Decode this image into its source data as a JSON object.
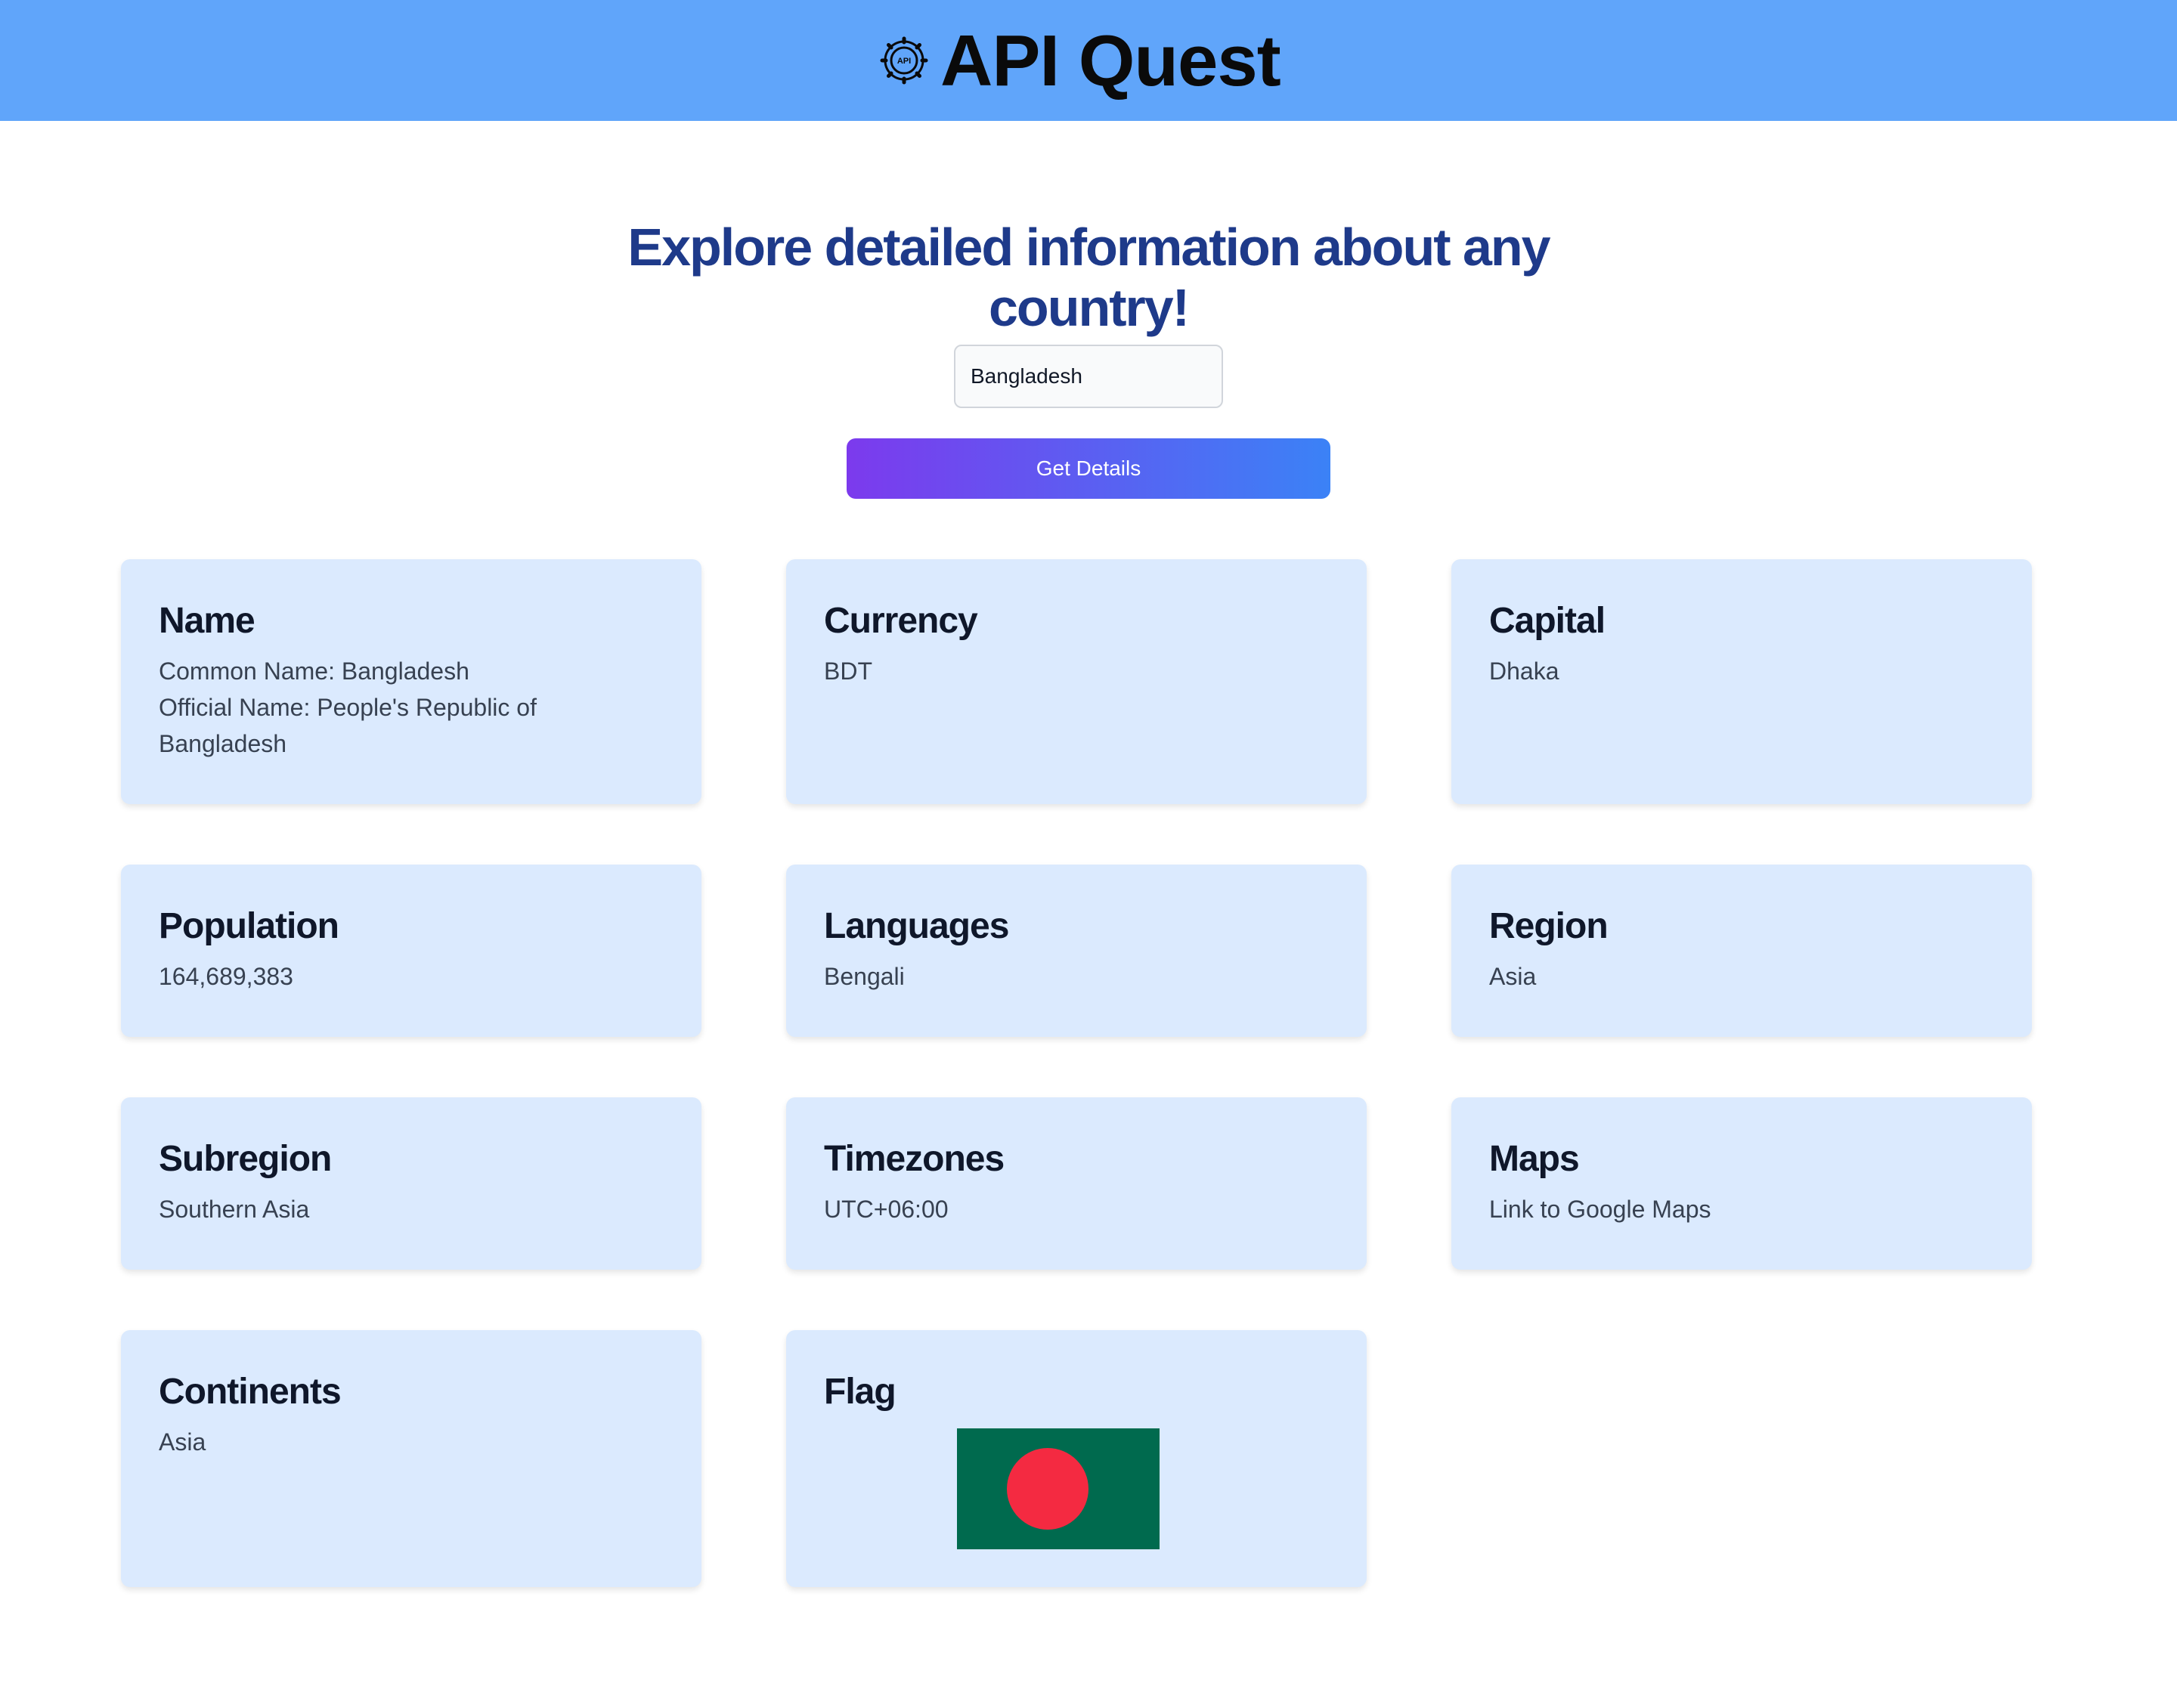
{
  "header": {
    "title": "API Quest",
    "logo_icon": "api-gear-icon",
    "logo_text": "API",
    "background": "#60a5fa"
  },
  "hero": {
    "headline": "Explore detailed information about any country!"
  },
  "search": {
    "value": "Bangladesh"
  },
  "actions": {
    "get_details_label": "Get Details"
  },
  "cards": {
    "name": {
      "title": "Name",
      "common": "Common Name: Bangladesh",
      "official": "Official Name: People's Republic of Bangladesh"
    },
    "currency": {
      "title": "Currency",
      "value": "BDT"
    },
    "capital": {
      "title": "Capital",
      "value": "Dhaka"
    },
    "population": {
      "title": "Population",
      "value": "164,689,383"
    },
    "languages": {
      "title": "Languages",
      "value": "Bengali"
    },
    "region": {
      "title": "Region",
      "value": "Asia"
    },
    "subregion": {
      "title": "Subregion",
      "value": "Southern Asia"
    },
    "timezones": {
      "title": "Timezones",
      "value": "UTC+06:00"
    },
    "maps": {
      "title": "Maps",
      "link_label": "Link to Google Maps"
    },
    "continents": {
      "title": "Continents",
      "value": "Asia"
    },
    "flag": {
      "title": "Flag",
      "field_color": "#006a4e",
      "disc_color": "#f42a41"
    }
  },
  "colors": {
    "headline": "#1e3a8a",
    "card_background": "#dbeafe",
    "button_gradient_start": "#7c3aed",
    "button_gradient_end": "#3b82f6"
  }
}
